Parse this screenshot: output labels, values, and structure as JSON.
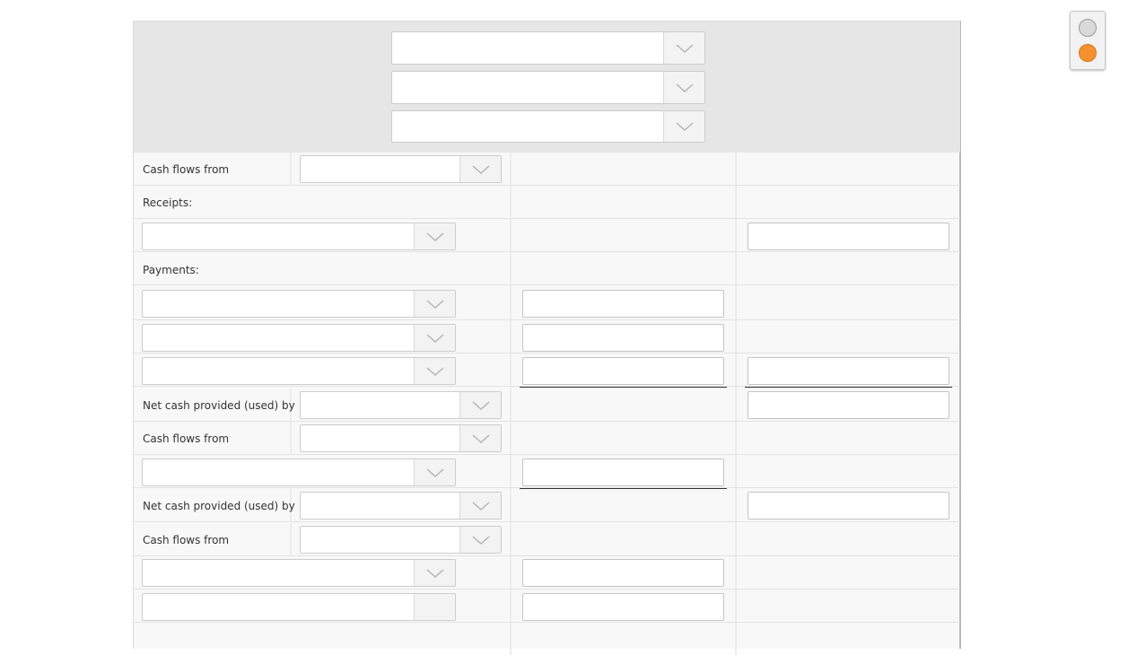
{
  "form": {
    "header_selects": [
      "",
      "",
      ""
    ],
    "cash_flows_from_label": "Cash flows from",
    "receipts_label": "Receipts:",
    "payments_label": "Payments:",
    "net_cash_label": "Net cash provided (used) by",
    "selected_values": {
      "section1": "",
      "receipt1": "",
      "payment1": "",
      "payment2": "",
      "payment3": "",
      "net1": "",
      "section2": "",
      "item2": "",
      "net2": "",
      "section3": "",
      "item3": ""
    },
    "amount_values": {
      "receipt_total": "",
      "payment1": "",
      "payment2": "",
      "payment3": "",
      "payments_total": "",
      "net1_total": "",
      "item2": "",
      "net2_total": "",
      "item3": ""
    }
  },
  "colors": {
    "header_bg": "#e6e6e6",
    "row_bg": "#f8f8f8",
    "active_indicator": "#f5922f",
    "inactive_indicator": "#d9d9d9"
  },
  "toggle": {
    "icons": [
      "circle-inactive-icon",
      "circle-active-icon"
    ]
  }
}
